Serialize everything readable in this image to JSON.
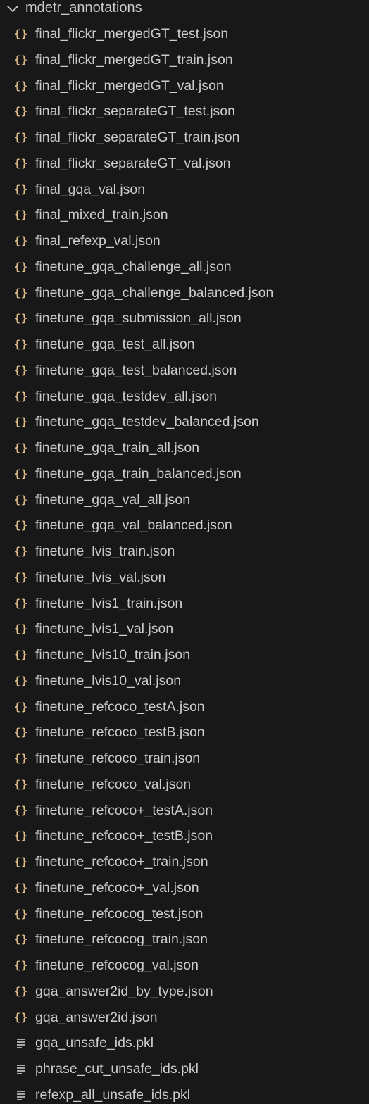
{
  "folder": {
    "name": "mdetr_annotations",
    "icon": "chevron-down-icon"
  },
  "files": [
    {
      "name": "final_flickr_mergedGT_test.json",
      "type": "json"
    },
    {
      "name": "final_flickr_mergedGT_train.json",
      "type": "json"
    },
    {
      "name": "final_flickr_mergedGT_val.json",
      "type": "json"
    },
    {
      "name": "final_flickr_separateGT_test.json",
      "type": "json"
    },
    {
      "name": "final_flickr_separateGT_train.json",
      "type": "json"
    },
    {
      "name": "final_flickr_separateGT_val.json",
      "type": "json"
    },
    {
      "name": "final_gqa_val.json",
      "type": "json"
    },
    {
      "name": "final_mixed_train.json",
      "type": "json"
    },
    {
      "name": "final_refexp_val.json",
      "type": "json"
    },
    {
      "name": "finetune_gqa_challenge_all.json",
      "type": "json"
    },
    {
      "name": "finetune_gqa_challenge_balanced.json",
      "type": "json"
    },
    {
      "name": "finetune_gqa_submission_all.json",
      "type": "json"
    },
    {
      "name": "finetune_gqa_test_all.json",
      "type": "json"
    },
    {
      "name": "finetune_gqa_test_balanced.json",
      "type": "json"
    },
    {
      "name": "finetune_gqa_testdev_all.json",
      "type": "json"
    },
    {
      "name": "finetune_gqa_testdev_balanced.json",
      "type": "json"
    },
    {
      "name": "finetune_gqa_train_all.json",
      "type": "json"
    },
    {
      "name": "finetune_gqa_train_balanced.json",
      "type": "json"
    },
    {
      "name": "finetune_gqa_val_all.json",
      "type": "json"
    },
    {
      "name": "finetune_gqa_val_balanced.json",
      "type": "json"
    },
    {
      "name": "finetune_lvis_train.json",
      "type": "json"
    },
    {
      "name": "finetune_lvis_val.json",
      "type": "json"
    },
    {
      "name": "finetune_lvis1_train.json",
      "type": "json"
    },
    {
      "name": "finetune_lvis1_val.json",
      "type": "json"
    },
    {
      "name": "finetune_lvis10_train.json",
      "type": "json"
    },
    {
      "name": "finetune_lvis10_val.json",
      "type": "json"
    },
    {
      "name": "finetune_refcoco_testA.json",
      "type": "json"
    },
    {
      "name": "finetune_refcoco_testB.json",
      "type": "json"
    },
    {
      "name": "finetune_refcoco_train.json",
      "type": "json"
    },
    {
      "name": "finetune_refcoco_val.json",
      "type": "json"
    },
    {
      "name": "finetune_refcoco+_testA.json",
      "type": "json"
    },
    {
      "name": "finetune_refcoco+_testB.json",
      "type": "json"
    },
    {
      "name": "finetune_refcoco+_train.json",
      "type": "json"
    },
    {
      "name": "finetune_refcoco+_val.json",
      "type": "json"
    },
    {
      "name": "finetune_refcocog_test.json",
      "type": "json"
    },
    {
      "name": "finetune_refcocog_train.json",
      "type": "json"
    },
    {
      "name": "finetune_refcocog_val.json",
      "type": "json"
    },
    {
      "name": "gqa_answer2id_by_type.json",
      "type": "json"
    },
    {
      "name": "gqa_answer2id.json",
      "type": "json"
    },
    {
      "name": "gqa_unsafe_ids.pkl",
      "type": "pkl"
    },
    {
      "name": "phrase_cut_unsafe_ids.pkl",
      "type": "pkl"
    },
    {
      "name": "refexp_all_unsafe_ids.pkl",
      "type": "pkl"
    }
  ],
  "icons": {
    "json": "json-braces-icon",
    "pkl": "text-lines-icon"
  },
  "colors": {
    "background": "#181818",
    "text": "#cccccc",
    "json_icon": "#e2c08d",
    "file_lines_icon": "#cccccc"
  }
}
